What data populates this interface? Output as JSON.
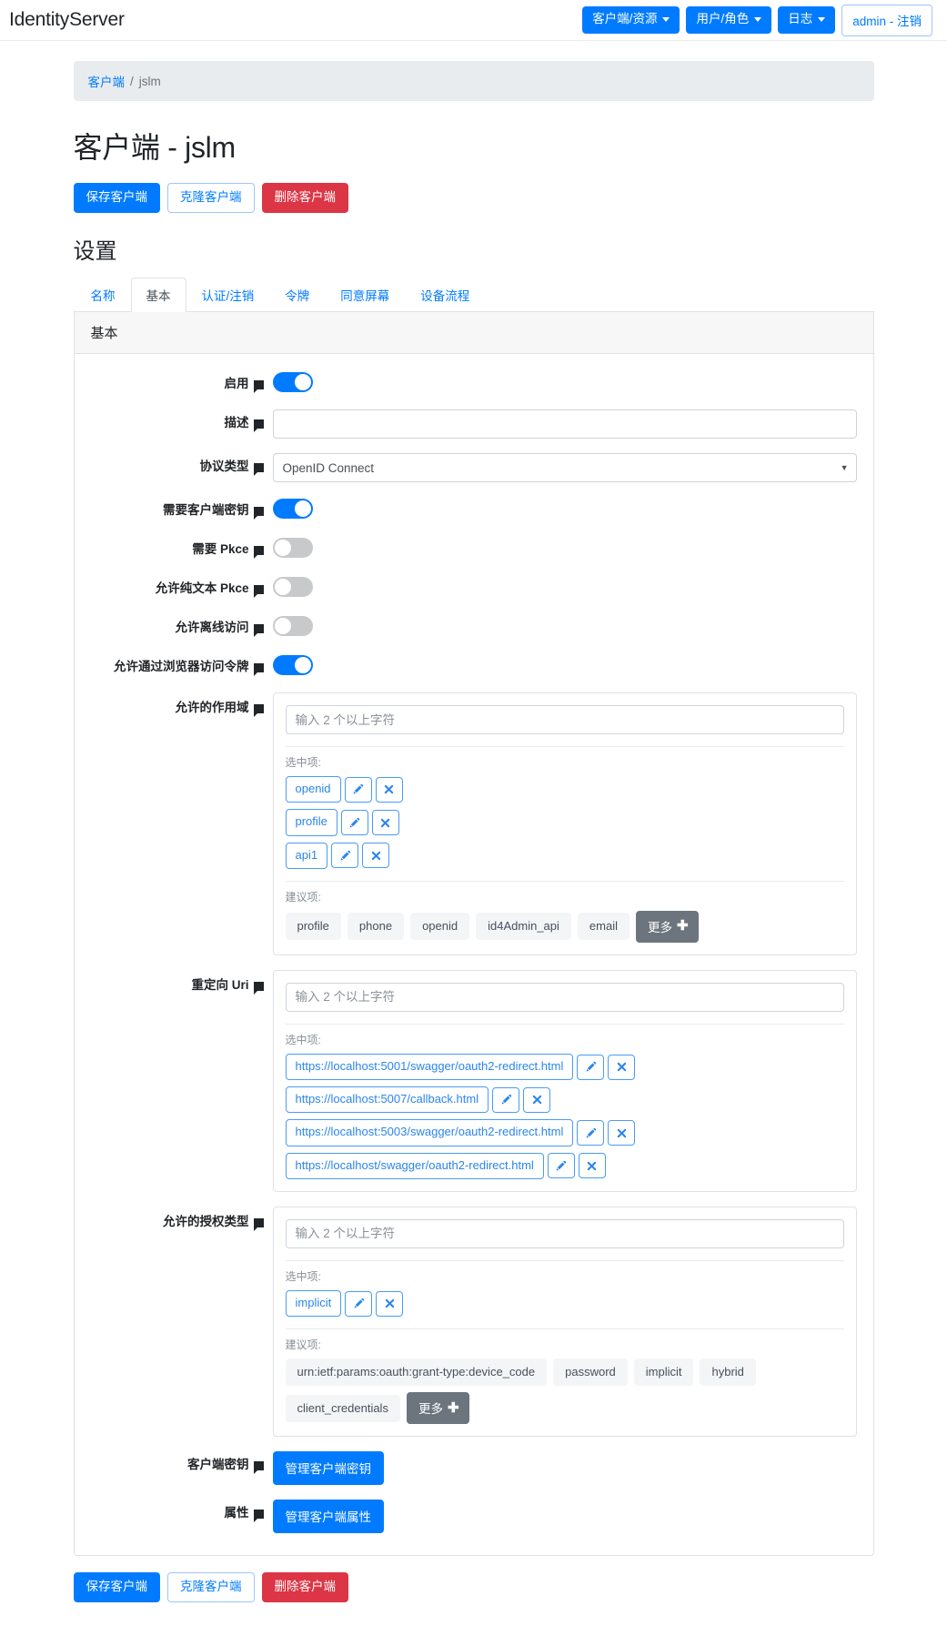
{
  "navbar": {
    "brand": "IdentityServer",
    "menus": [
      {
        "label": "客户端/资源",
        "icon": "chevron-down-icon"
      },
      {
        "label": "用户/角色",
        "icon": "chevron-down-icon"
      },
      {
        "label": "日志",
        "icon": "chevron-down-icon"
      }
    ],
    "account": "admin - 注销"
  },
  "breadcrumb": {
    "root": "客户端",
    "separator": "/",
    "current": "jslm"
  },
  "page": {
    "title": "客户端 - jslm",
    "settings_heading": "设置"
  },
  "actions": {
    "save": "保存客户端",
    "clone": "克隆客户端",
    "delete": "删除客户端"
  },
  "tabs": [
    {
      "label": "名称",
      "active": false
    },
    {
      "label": "基本",
      "active": true
    },
    {
      "label": "认证/注销",
      "active": false
    },
    {
      "label": "令牌",
      "active": false
    },
    {
      "label": "同意屏幕",
      "active": false
    },
    {
      "label": "设备流程",
      "active": false
    }
  ],
  "card": {
    "header": "基本"
  },
  "common": {
    "placeholder": "输入 2 个以上字符",
    "selected_caption": "选中项:",
    "suggested_caption": "建议项:",
    "more_label": "更多",
    "info_icon": "speech-bubble-icon",
    "edit_icon": "pencil-icon",
    "remove_icon": "close-icon"
  },
  "fields": {
    "enabled": {
      "label": "启用",
      "value": true
    },
    "description": {
      "label": "描述",
      "value": ""
    },
    "protocol_type": {
      "label": "协议类型",
      "value": "OpenID Connect"
    },
    "require_secret": {
      "label": "需要客户端密钥",
      "value": true
    },
    "require_pkce": {
      "label": "需要 Pkce",
      "value": false
    },
    "allow_plain_pkce": {
      "label": "允许纯文本 Pkce",
      "value": false
    },
    "allow_offline": {
      "label": "允许离线访问",
      "value": false
    },
    "allow_browser_token": {
      "label": "允许通过浏览器访问令牌",
      "value": true
    },
    "allowed_scopes": {
      "label": "允许的作用域",
      "selected": [
        "openid",
        "profile",
        "api1"
      ],
      "suggested": [
        "profile",
        "phone",
        "openid",
        "id4Admin_api",
        "email"
      ]
    },
    "redirect_uris": {
      "label": "重定向 Uri",
      "selected": [
        "https://localhost:5001/swagger/oauth2-redirect.html",
        "https://localhost:5007/callback.html",
        "https://localhost:5003/swagger/oauth2-redirect.html",
        "https://localhost/swagger/oauth2-redirect.html"
      ],
      "suggested": []
    },
    "grant_types": {
      "label": "允许的授权类型",
      "selected": [
        "implicit"
      ],
      "suggested": [
        "urn:ietf:params:oauth:grant-type:device_code",
        "password",
        "implicit",
        "hybrid",
        "client_credentials"
      ]
    },
    "client_secrets": {
      "label": "客户端密钥",
      "button": "管理客户端密钥"
    },
    "properties": {
      "label": "属性",
      "button": "管理客户端属性"
    }
  },
  "colors": {
    "primary": "#007bff",
    "danger": "#dc3545",
    "secondary": "#6c757d",
    "chip_border": "#4a9bf5"
  }
}
